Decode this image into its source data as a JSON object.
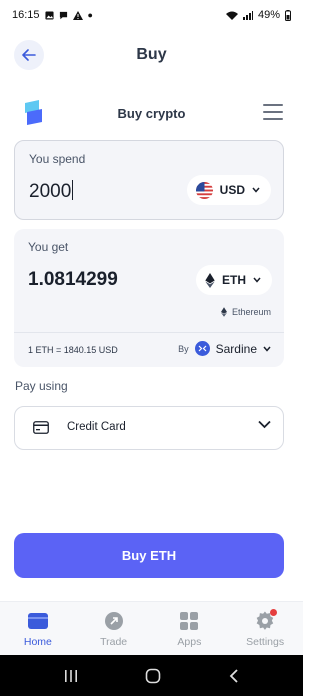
{
  "status_bar": {
    "time": "16:15",
    "battery": "49%",
    "left_icons": [
      "gallery-icon",
      "message-icon",
      "warning-icon",
      "dot-icon"
    ],
    "right_icons": [
      "wifi-icon",
      "signal-icon",
      "battery-icon"
    ]
  },
  "header": {
    "title": "Buy",
    "back_icon": "back-arrow-icon"
  },
  "widget": {
    "title": "Buy crypto",
    "menu_icon": "hamburger-menu-icon"
  },
  "spend": {
    "label": "You spend",
    "amount": "2000",
    "currency": "USD",
    "currency_icon": "us-flag-icon"
  },
  "get": {
    "label": "You get",
    "amount": "1.0814299",
    "currency": "ETH",
    "network": "Ethereum",
    "rate": "1 ETH = 1840.15 USD",
    "provider_prefix": "By",
    "provider": "Sardine"
  },
  "payment": {
    "label": "Pay using",
    "method": "Credit Card",
    "method_icon": "credit-card-icon"
  },
  "cta": {
    "label": "Buy ETH"
  },
  "bottom_nav": {
    "items": [
      {
        "label": "Home",
        "active": true,
        "icon": "home-wallet-icon"
      },
      {
        "label": "Trade",
        "active": false,
        "icon": "trade-icon"
      },
      {
        "label": "Apps",
        "active": false,
        "icon": "apps-grid-icon"
      },
      {
        "label": "Settings",
        "active": false,
        "icon": "settings-gear-icon"
      }
    ]
  },
  "colors": {
    "accent": "#5b63f5",
    "active_nav": "#3b5bdb",
    "card_bg": "#f4f5f9"
  }
}
